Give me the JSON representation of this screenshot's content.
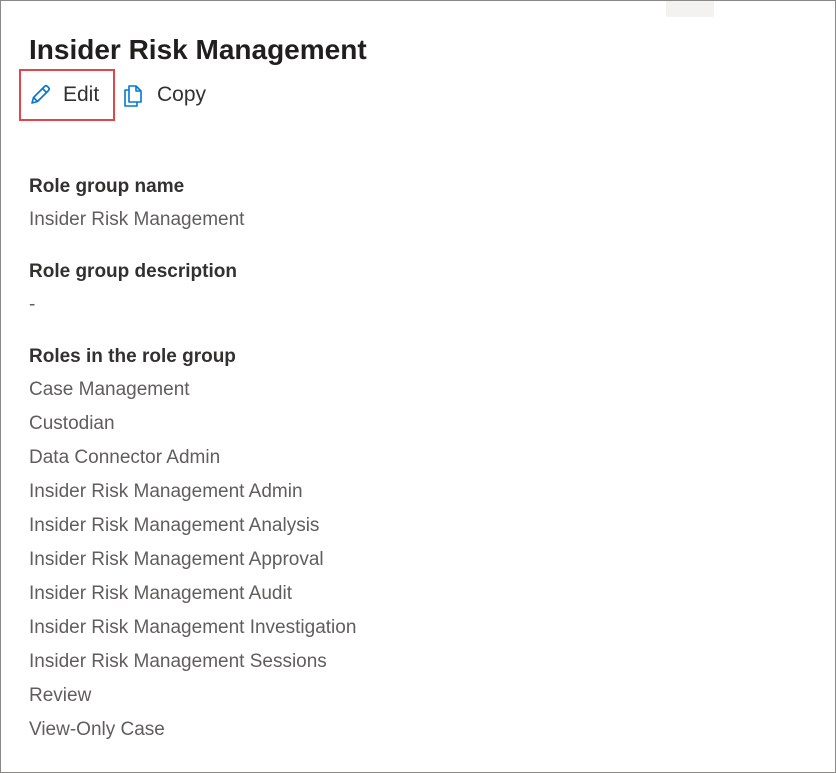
{
  "panel": {
    "title": "Insider Risk Management"
  },
  "toolbar": {
    "edit_label": "Edit",
    "copy_label": "Copy",
    "edit_icon": "pencil-icon",
    "copy_icon": "copy-icon"
  },
  "details": {
    "role_group_name_label": "Role group name",
    "role_group_name_value": "Insider Risk Management",
    "role_group_description_label": "Role group description",
    "role_group_description_value": "-",
    "roles_label": "Roles in the role group",
    "roles": [
      "Case Management",
      "Custodian",
      "Data Connector Admin",
      "Insider Risk Management Admin",
      "Insider Risk Management Analysis",
      "Insider Risk Management Approval",
      "Insider Risk Management Audit",
      "Insider Risk Management Investigation",
      "Insider Risk Management Sessions",
      "Review",
      "View-Only Case"
    ]
  },
  "colors": {
    "accent": "#0078d4",
    "highlight_border": "#e0474c",
    "label_text": "#323130",
    "value_text": "#605e5c"
  }
}
